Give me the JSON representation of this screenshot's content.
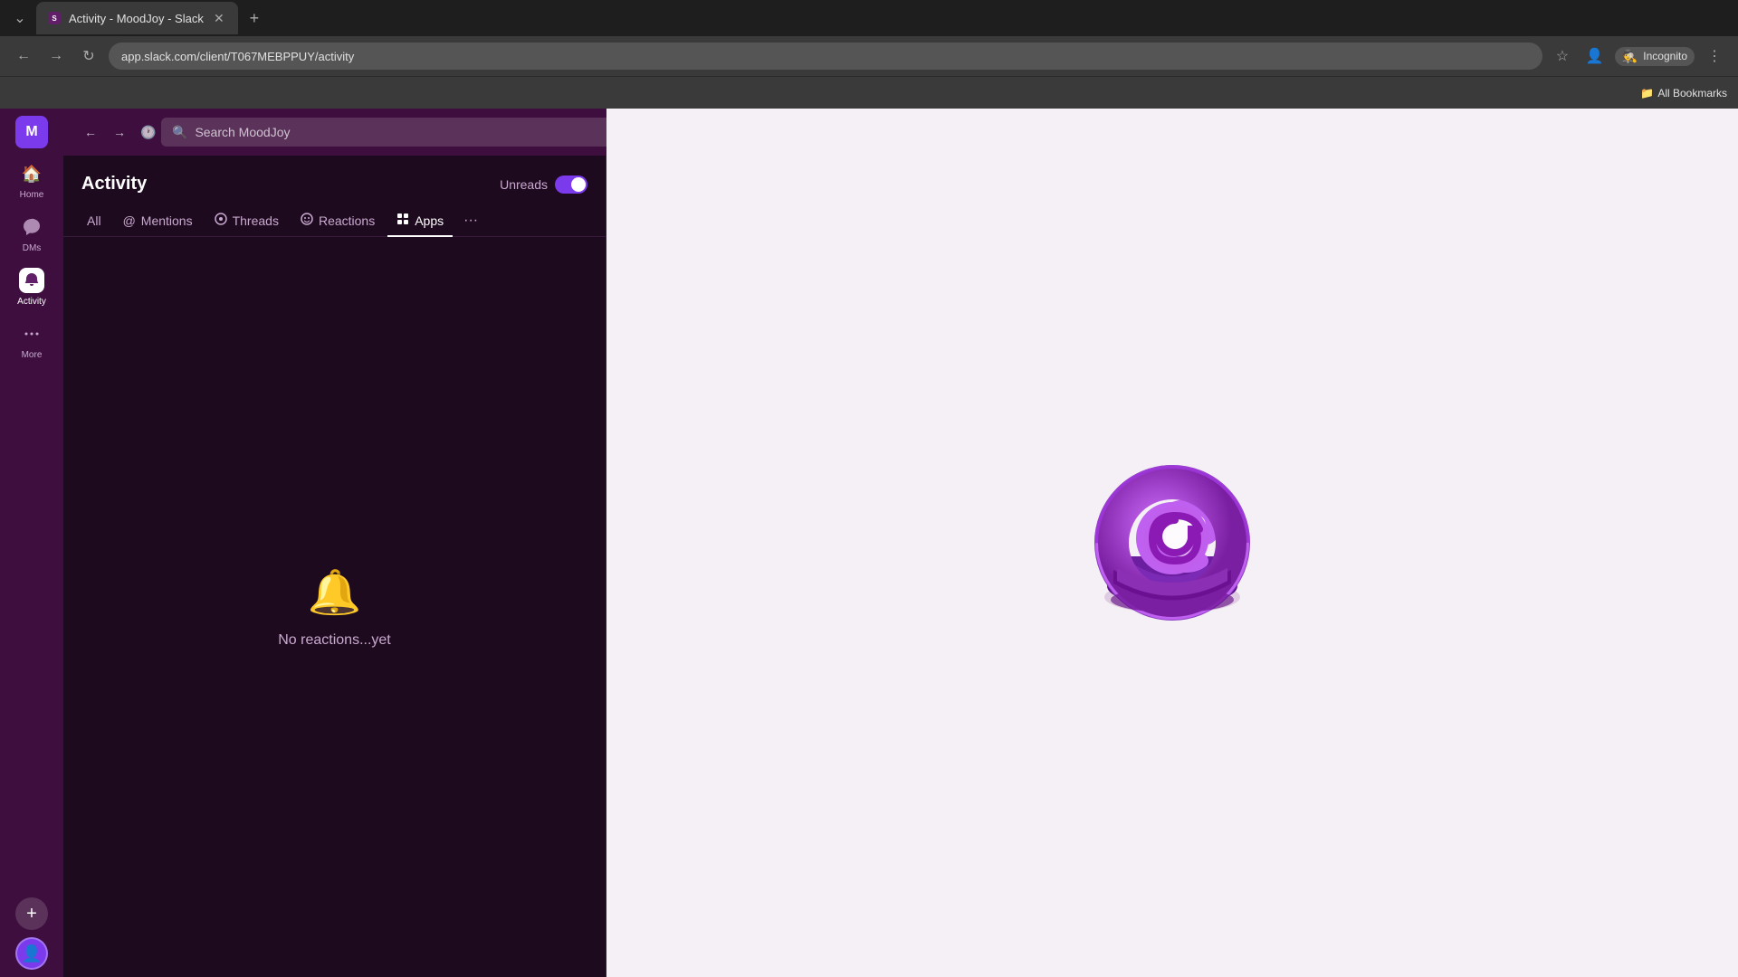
{
  "browser": {
    "tab": {
      "title": "Activity - MoodJoy - Slack",
      "favicon": "S"
    },
    "url": "app.slack.com/client/T067MEBPPUY/activity",
    "bookmarks": {
      "label": "All Bookmarks"
    },
    "incognito": "Incognito"
  },
  "topbar": {
    "search_placeholder": "Search MoodJoy",
    "nav_back": "←",
    "nav_forward": "→",
    "nav_history": "🕐",
    "help_icon": "?"
  },
  "sidebar": {
    "workspace_initial": "M",
    "items": [
      {
        "id": "home",
        "label": "Home",
        "icon": "🏠",
        "active": false
      },
      {
        "id": "dms",
        "label": "DMs",
        "icon": "💬",
        "active": false
      },
      {
        "id": "activity",
        "label": "Activity",
        "icon": "🔔",
        "active": true
      },
      {
        "id": "more",
        "label": "More",
        "icon": "•••",
        "active": false
      }
    ],
    "add_button": "+",
    "user_avatar": "👤"
  },
  "activity": {
    "title": "Activity",
    "unreads_label": "Unreads",
    "tabs": [
      {
        "id": "all",
        "label": "All",
        "icon": "",
        "active": false
      },
      {
        "id": "mentions",
        "label": "Mentions",
        "icon": "@",
        "active": false
      },
      {
        "id": "threads",
        "label": "Threads",
        "icon": "💬",
        "active": false
      },
      {
        "id": "reactions",
        "label": "Reactions",
        "icon": "😊",
        "active": true
      },
      {
        "id": "apps",
        "label": "Apps",
        "icon": "⊞",
        "active": false
      }
    ],
    "more_icon": "...",
    "empty_icon": "🔔",
    "empty_text": "No reactions...yet"
  },
  "colors": {
    "sidebar_bg": "#3e0f3e",
    "panel_bg": "#1e0a1e",
    "accent": "#7c3aed",
    "right_bg": "#f5f0f5"
  }
}
